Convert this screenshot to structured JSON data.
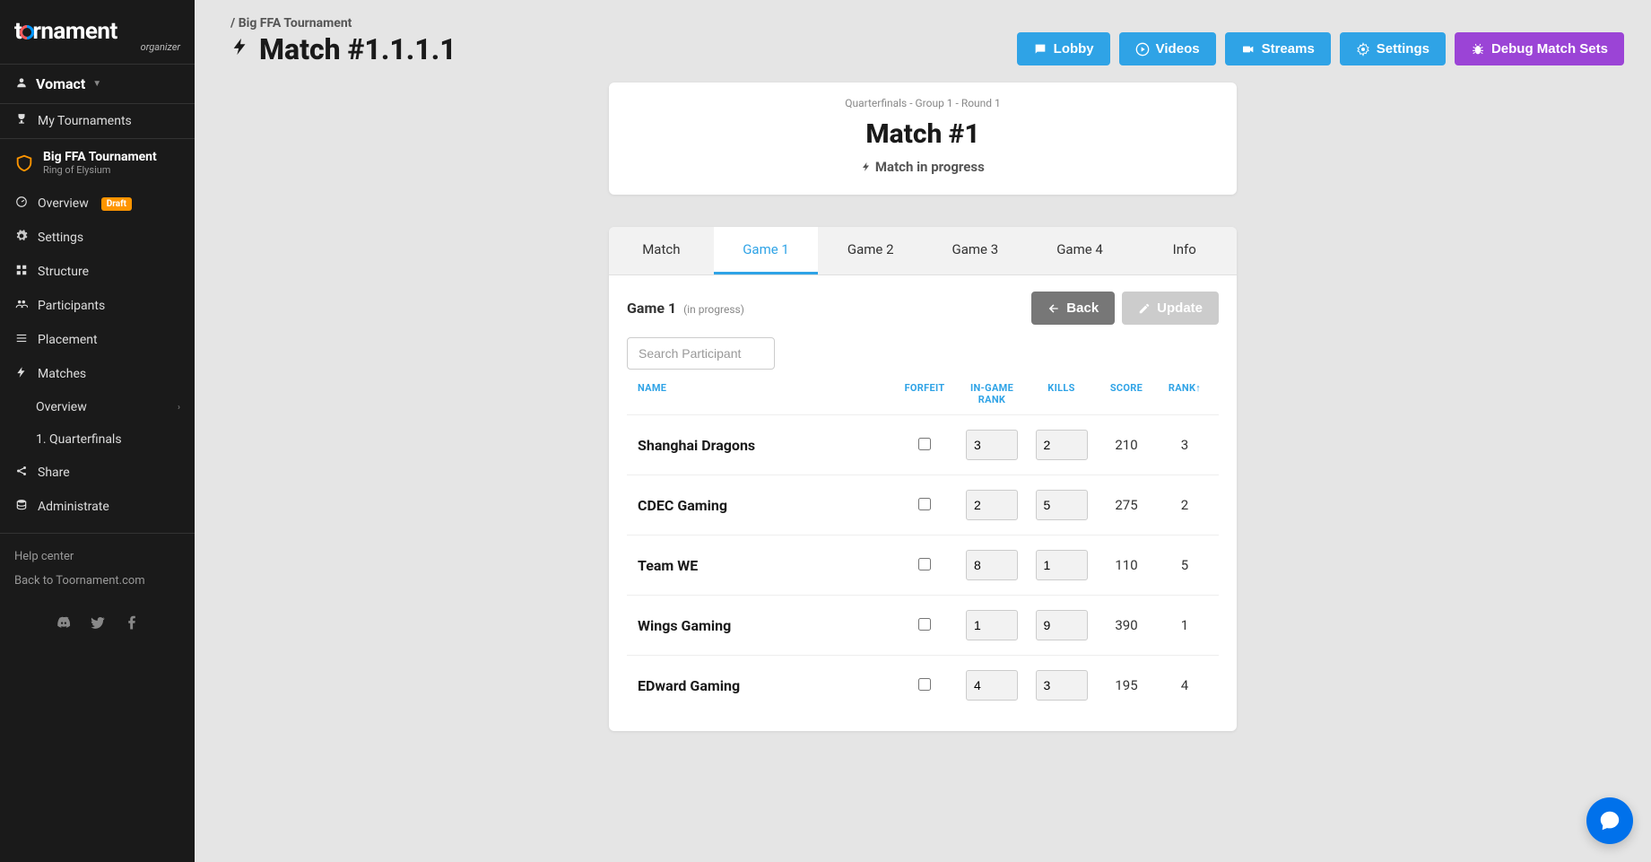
{
  "logo": {
    "brand": "toornament",
    "sub": "organizer"
  },
  "user": {
    "name": "Vomact"
  },
  "sidebar": {
    "myTournaments": "My Tournaments",
    "tournament": {
      "name": "Big FFA Tournament",
      "game": "Ring of Elysium"
    },
    "items": {
      "overview": "Overview",
      "overviewBadge": "Draft",
      "settings": "Settings",
      "structure": "Structure",
      "participants": "Participants",
      "placement": "Placement",
      "matches": "Matches",
      "matchesOverview": "Overview",
      "quarterfinals": "1. Quarterfinals",
      "share": "Share",
      "administrate": "Administrate"
    },
    "footer": {
      "help": "Help center",
      "back": "Back to Toornament.com"
    }
  },
  "header": {
    "breadcrumbPrefix": "/ ",
    "breadcrumb": "Big FFA Tournament",
    "title": "Match #1.1.1.1",
    "buttons": {
      "lobby": "Lobby",
      "videos": "Videos",
      "streams": "Streams",
      "settings": "Settings",
      "debug": "Debug Match Sets"
    }
  },
  "matchCard": {
    "stage": "Quarterfinals - Group 1 - Round 1",
    "title": "Match #1",
    "status": "Match in progress"
  },
  "tabs": {
    "match": "Match",
    "game1": "Game 1",
    "game2": "Game 2",
    "game3": "Game 3",
    "game4": "Game 4",
    "info": "Info"
  },
  "panel": {
    "title": "Game 1",
    "subtitle": "(in progress)",
    "back": "Back",
    "update": "Update",
    "searchPlaceholder": "Search Participant"
  },
  "tableHeaders": {
    "name": "NAME",
    "forfeit": "FORFEIT",
    "ingameRank": "IN-GAME RANK",
    "kills": "KILLS",
    "score": "SCORE",
    "rank": "RANK"
  },
  "rows": [
    {
      "name": "Shanghai Dragons",
      "ingameRank": "3",
      "kills": "2",
      "score": "210",
      "rank": "3"
    },
    {
      "name": "CDEC Gaming",
      "ingameRank": "2",
      "kills": "5",
      "score": "275",
      "rank": "2"
    },
    {
      "name": "Team WE",
      "ingameRank": "8",
      "kills": "1",
      "score": "110",
      "rank": "5"
    },
    {
      "name": "Wings Gaming",
      "ingameRank": "1",
      "kills": "9",
      "score": "390",
      "rank": "1"
    },
    {
      "name": "EDward Gaming",
      "ingameRank": "4",
      "kills": "3",
      "score": "195",
      "rank": "4"
    }
  ]
}
